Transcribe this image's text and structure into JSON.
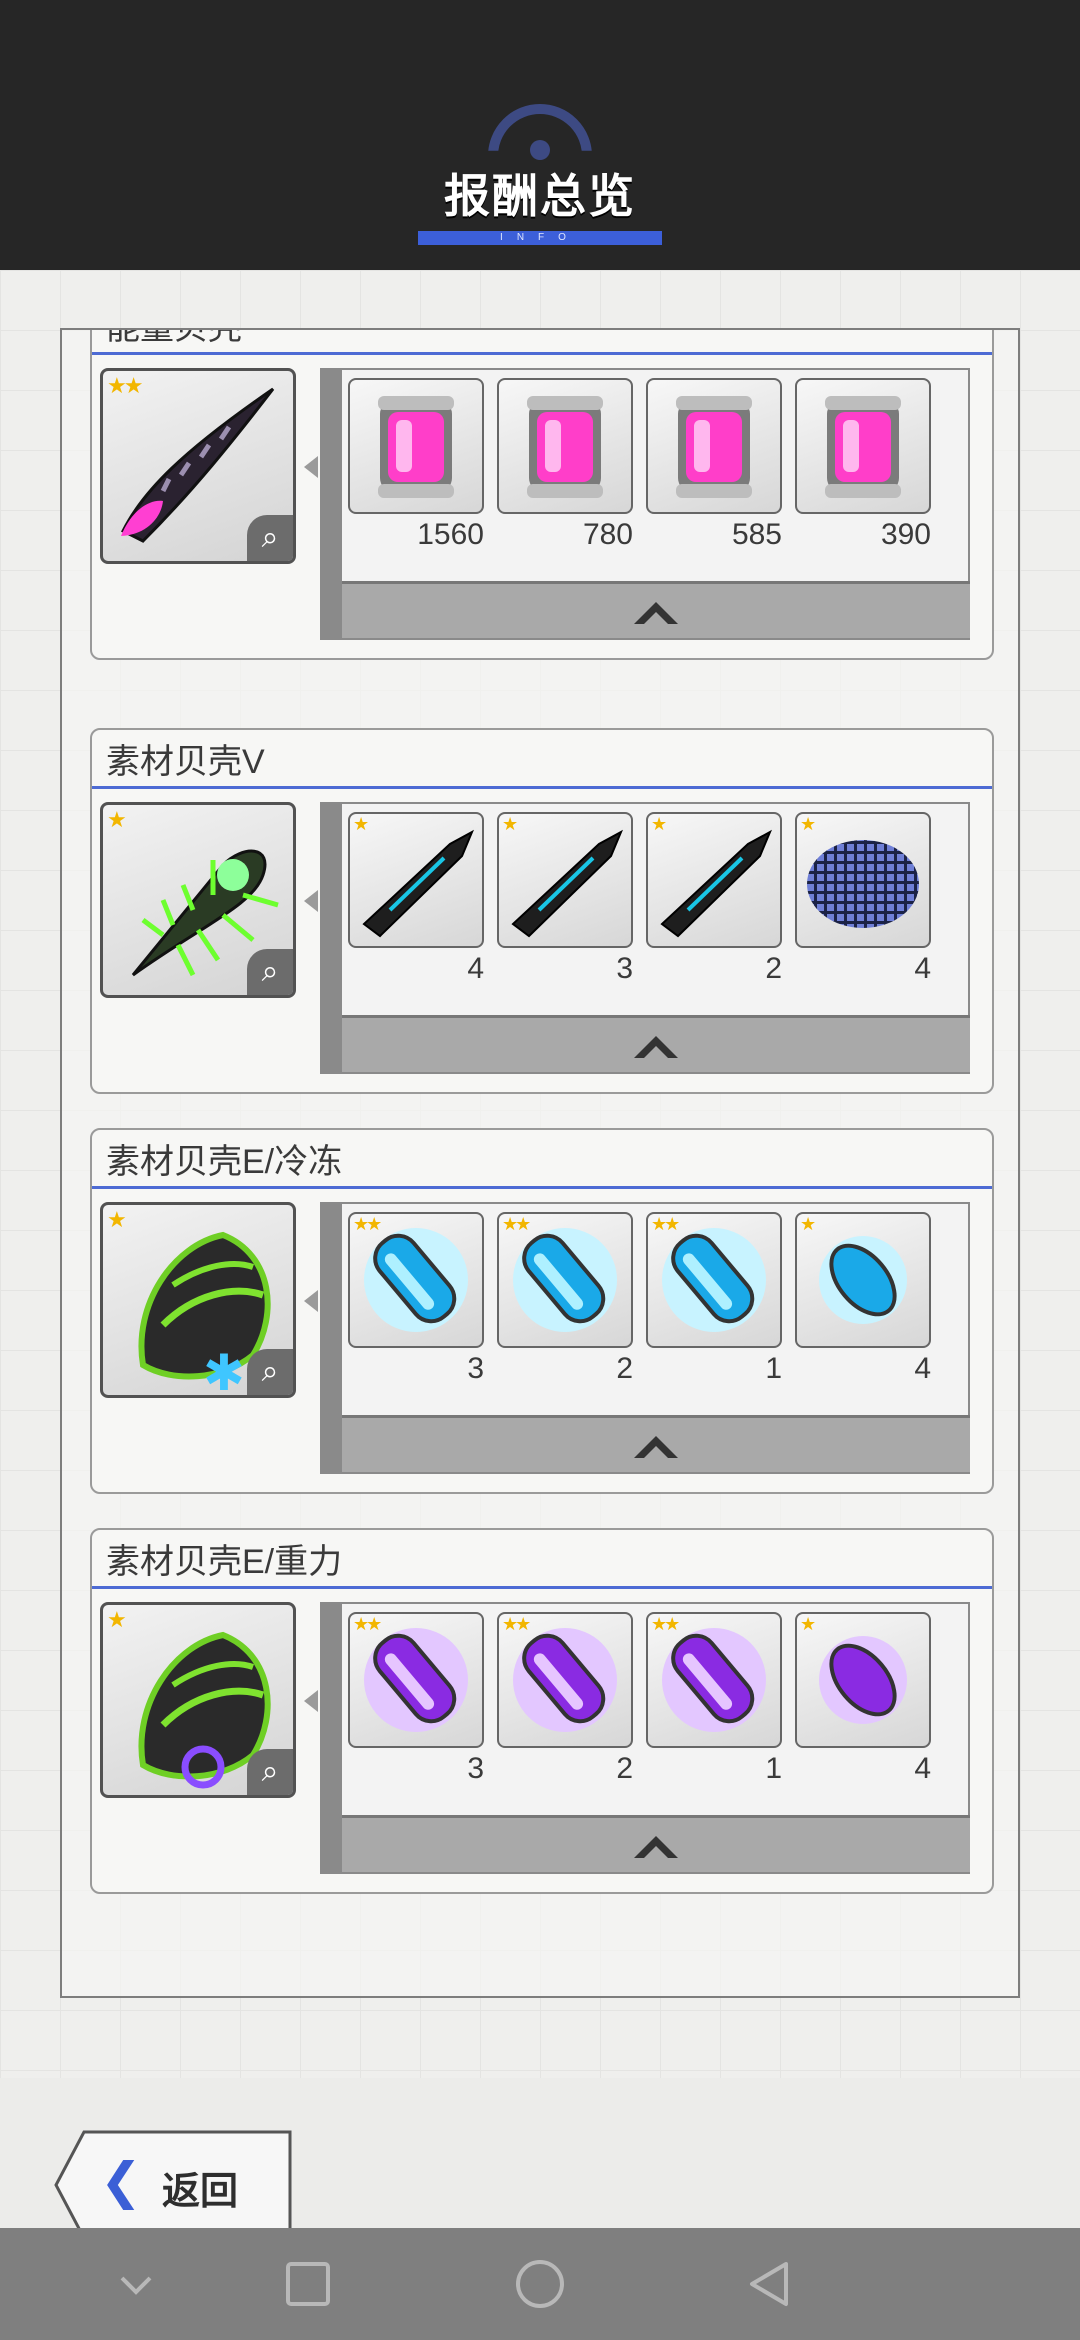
{
  "header": {
    "title": "报酬总览",
    "subtitle": "INFO"
  },
  "cards": [
    {
      "title": "能量贝壳",
      "main_item": {
        "stars": 2,
        "icon": "energy-shell-spike-icon"
      },
      "rewards": [
        {
          "icon": "pink-energy-canister-icon",
          "qty": "1560",
          "stars": 0
        },
        {
          "icon": "pink-energy-canister-icon",
          "qty": "780",
          "stars": 0
        },
        {
          "icon": "pink-energy-canister-icon",
          "qty": "585",
          "stars": 0
        },
        {
          "icon": "pink-energy-canister-icon",
          "qty": "390",
          "stars": 0
        }
      ]
    },
    {
      "title": "素材贝壳V",
      "main_item": {
        "stars": 1,
        "icon": "green-spiked-shell-icon"
      },
      "rewards": [
        {
          "icon": "dark-blade-part-icon",
          "qty": "4",
          "stars": 1
        },
        {
          "icon": "dark-blade-part-icon",
          "qty": "3",
          "stars": 1
        },
        {
          "icon": "dark-blade-part-icon",
          "qty": "2",
          "stars": 1
        },
        {
          "icon": "mesh-plate-icon",
          "qty": "4",
          "stars": 1
        }
      ]
    },
    {
      "title": "素材贝壳E/冷冻",
      "main_item": {
        "stars": 1,
        "icon": "cone-shell-freeze-icon"
      },
      "rewards": [
        {
          "icon": "blue-capsule-icon",
          "qty": "3",
          "stars": 2
        },
        {
          "icon": "blue-capsule-icon",
          "qty": "2",
          "stars": 2
        },
        {
          "icon": "blue-capsule-icon",
          "qty": "1",
          "stars": 2
        },
        {
          "icon": "small-blue-capsule-icon",
          "qty": "4",
          "stars": 1
        }
      ]
    },
    {
      "title": "素材贝壳E/重力",
      "main_item": {
        "stars": 1,
        "icon": "cone-shell-gravity-icon"
      },
      "rewards": [
        {
          "icon": "purple-capsule-icon",
          "qty": "3",
          "stars": 2
        },
        {
          "icon": "purple-capsule-icon",
          "qty": "2",
          "stars": 2
        },
        {
          "icon": "purple-capsule-icon",
          "qty": "1",
          "stars": 2
        },
        {
          "icon": "small-purple-capsule-icon",
          "qty": "4",
          "stars": 1
        }
      ]
    }
  ],
  "back_button": {
    "label": "返回"
  },
  "colors": {
    "accent": "#3c5fd9",
    "header_bg": "#262626",
    "star": "#f2b600"
  }
}
